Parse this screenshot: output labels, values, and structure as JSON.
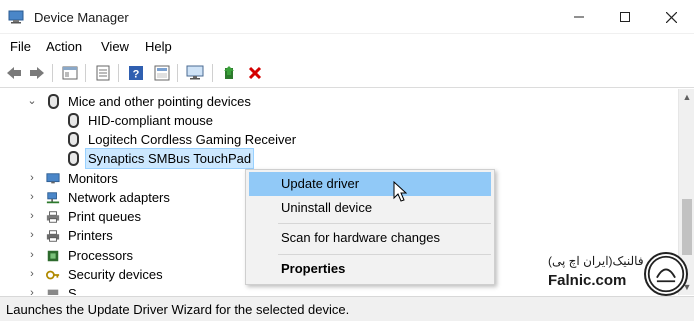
{
  "window": {
    "title": "Device Manager"
  },
  "menu": [
    "File",
    "Action",
    "View",
    "Help"
  ],
  "toolbar": {
    "buttons": [
      "back-icon",
      "forward-icon",
      "properties-pane-icon",
      "list-icon",
      "help-icon",
      "update-view-icon",
      "monitor-scan-icon",
      "add-driver-icon",
      "uninstall-x-icon"
    ]
  },
  "tree": {
    "expanded_category": "Mice and other pointing devices",
    "children": [
      "HID-compliant mouse",
      "Logitech Cordless Gaming Receiver",
      "Synaptics SMBus TouchPad"
    ],
    "selected": "Synaptics SMBus TouchPad",
    "categories": [
      "Monitors",
      "Network adapters",
      "Print queues",
      "Printers",
      "Processors",
      "Security devices",
      "S..."
    ]
  },
  "context_menu": {
    "items": [
      "Update driver",
      "Uninstall device",
      "Scan for hardware changes",
      "Properties"
    ]
  },
  "status": "Launches the Update Driver Wizard for the selected device.",
  "watermark": {
    "brand": "Falnic.com",
    "brand_fa": "فالنیک(ایران اچ پی)"
  },
  "colors": {
    "selection": "#cce8ff",
    "menu_hover": "#91c9f7",
    "close_red": "#d40000"
  }
}
